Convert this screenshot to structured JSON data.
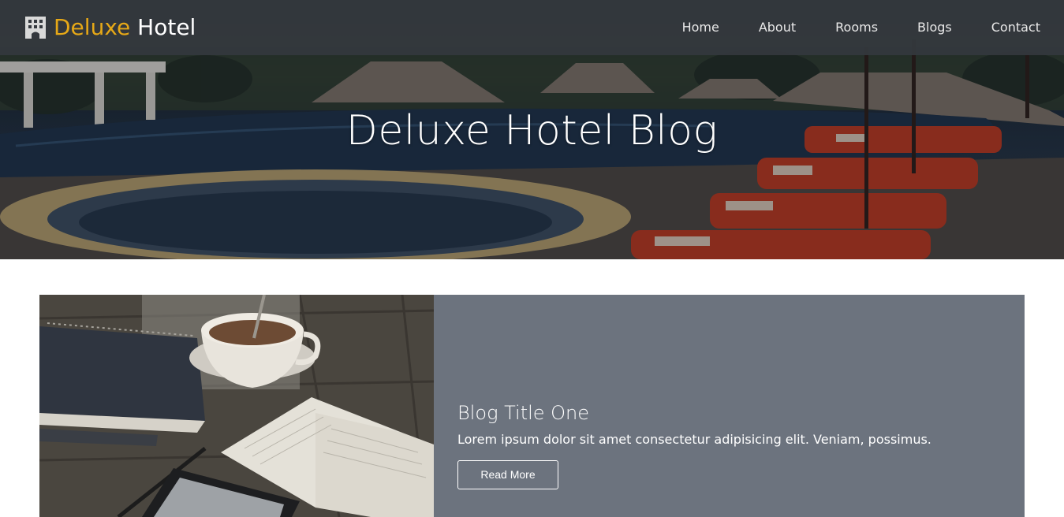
{
  "brand": {
    "name_accent": "Deluxe",
    "name_rest": "Hotel",
    "icon": "hotel-building-icon",
    "accent_color": "#e6a817"
  },
  "nav": {
    "items": [
      {
        "label": "Home"
      },
      {
        "label": "About"
      },
      {
        "label": "Rooms"
      },
      {
        "label": "Blogs"
      },
      {
        "label": "Contact"
      }
    ]
  },
  "hero": {
    "title": "Deluxe Hotel Blog"
  },
  "blog_post": {
    "title": "Blog Title One",
    "excerpt": "Lorem ipsum dolor sit amet consectetur adipisicing elit. Veniam, possimus.",
    "button_label": "Read More",
    "panel_color": "#6c737e"
  }
}
